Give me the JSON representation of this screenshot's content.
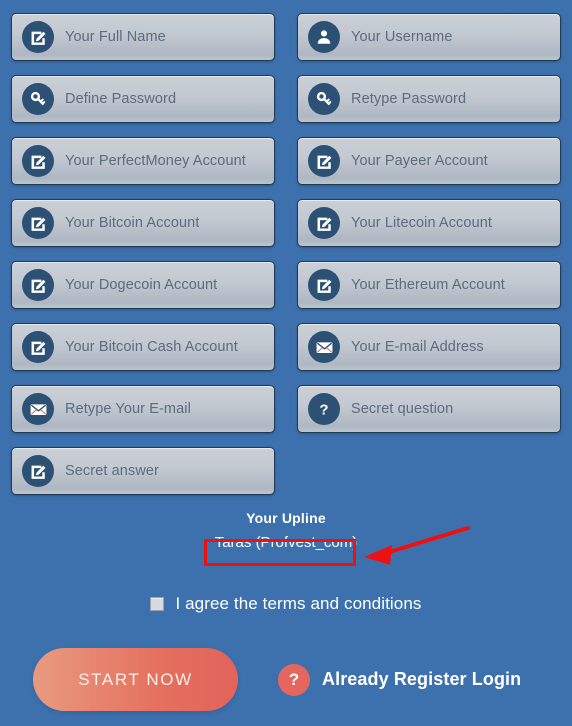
{
  "theme": {
    "background": "#3d71ad",
    "field_face_top": "#cbd0d6",
    "field_face_bottom": "#aeb7c2",
    "field_border": "#223b55",
    "icon_circle": "#2d5075",
    "accent_coral": "#e4665e",
    "annotation_red": "#ee1111",
    "label_text": "#5c6b7d"
  },
  "form": {
    "fields": [
      {
        "label": "Your Full Name",
        "icon": "edit-pencil-square-icon",
        "column": "left",
        "name": "full-name"
      },
      {
        "label": "Your Username",
        "icon": "user-person-icon",
        "column": "right",
        "name": "username"
      },
      {
        "label": "Define Password",
        "icon": "key-icon",
        "column": "left",
        "name": "define-password"
      },
      {
        "label": "Retype Password",
        "icon": "key-icon",
        "column": "right",
        "name": "retype-password"
      },
      {
        "label": "Your PerfectMoney Account",
        "icon": "edit-pencil-square-icon",
        "column": "left",
        "name": "perfectmoney-account"
      },
      {
        "label": "Your Payeer Account",
        "icon": "edit-pencil-square-icon",
        "column": "right",
        "name": "payeer-account"
      },
      {
        "label": "Your Bitcoin Account",
        "icon": "edit-pencil-square-icon",
        "column": "left",
        "name": "bitcoin-account"
      },
      {
        "label": "Your Litecoin Account",
        "icon": "edit-pencil-square-icon",
        "column": "right",
        "name": "litecoin-account"
      },
      {
        "label": "Your Dogecoin Account",
        "icon": "edit-pencil-square-icon",
        "column": "left",
        "name": "dogecoin-account"
      },
      {
        "label": "Your Ethereum Account",
        "icon": "edit-pencil-square-icon",
        "column": "right",
        "name": "ethereum-account"
      },
      {
        "label": "Your Bitcoin Cash Account",
        "icon": "edit-pencil-square-icon",
        "column": "left",
        "name": "bitcoin-cash-account"
      },
      {
        "label": "Your E-mail Address",
        "icon": "envelope-mail-icon",
        "column": "right",
        "name": "email-address"
      },
      {
        "label": "Retype Your E-mail",
        "icon": "envelope-mail-icon",
        "column": "left",
        "name": "retype-email"
      },
      {
        "label": "Secret question",
        "icon": "question-mark-icon",
        "column": "right",
        "name": "secret-question"
      },
      {
        "label": "Secret answer",
        "icon": "edit-pencil-square-icon",
        "column": "left",
        "name": "secret-answer"
      }
    ]
  },
  "upline": {
    "title": "Your Upline",
    "value": "Taras (Profvest_com)"
  },
  "terms": {
    "label": "I agree the terms and conditions",
    "checked": false
  },
  "actions": {
    "start_label": "START NOW",
    "login_badge": "?",
    "login_label": "Already Register Login"
  }
}
